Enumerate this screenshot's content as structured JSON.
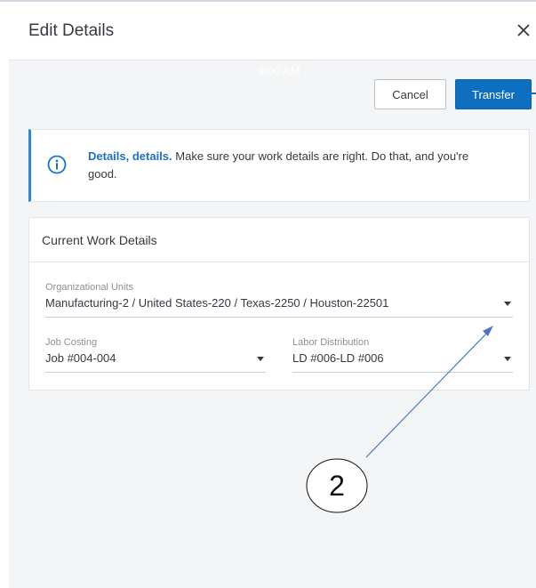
{
  "dialog": {
    "title": "Edit Details",
    "status_time": "9:00 AM",
    "cancel_label": "Cancel",
    "transfer_label": "Transfer"
  },
  "info": {
    "heading": "Details, details.",
    "message": "Make sure your work details are right. Do that, and you're good."
  },
  "work_details": {
    "title": "Current Work Details",
    "org_units": {
      "label": "Organizational Units",
      "value": "Manufacturing-2 / United States-220 / Texas-2250 / Houston-22501"
    },
    "job_costing": {
      "label": "Job Costing",
      "value": "Job #004-004"
    },
    "labor_distribution": {
      "label": "Labor Distribution",
      "value": "LD #006-LD #006"
    }
  },
  "annotation": {
    "callout": "2"
  },
  "colors": {
    "accent": "#0e6fc0",
    "info_accent": "#2f86d6",
    "callout_arrow": "#4a78c0"
  },
  "icons": {
    "close": "close-icon",
    "info": "info-icon",
    "dropdown": "caret-down-icon"
  }
}
